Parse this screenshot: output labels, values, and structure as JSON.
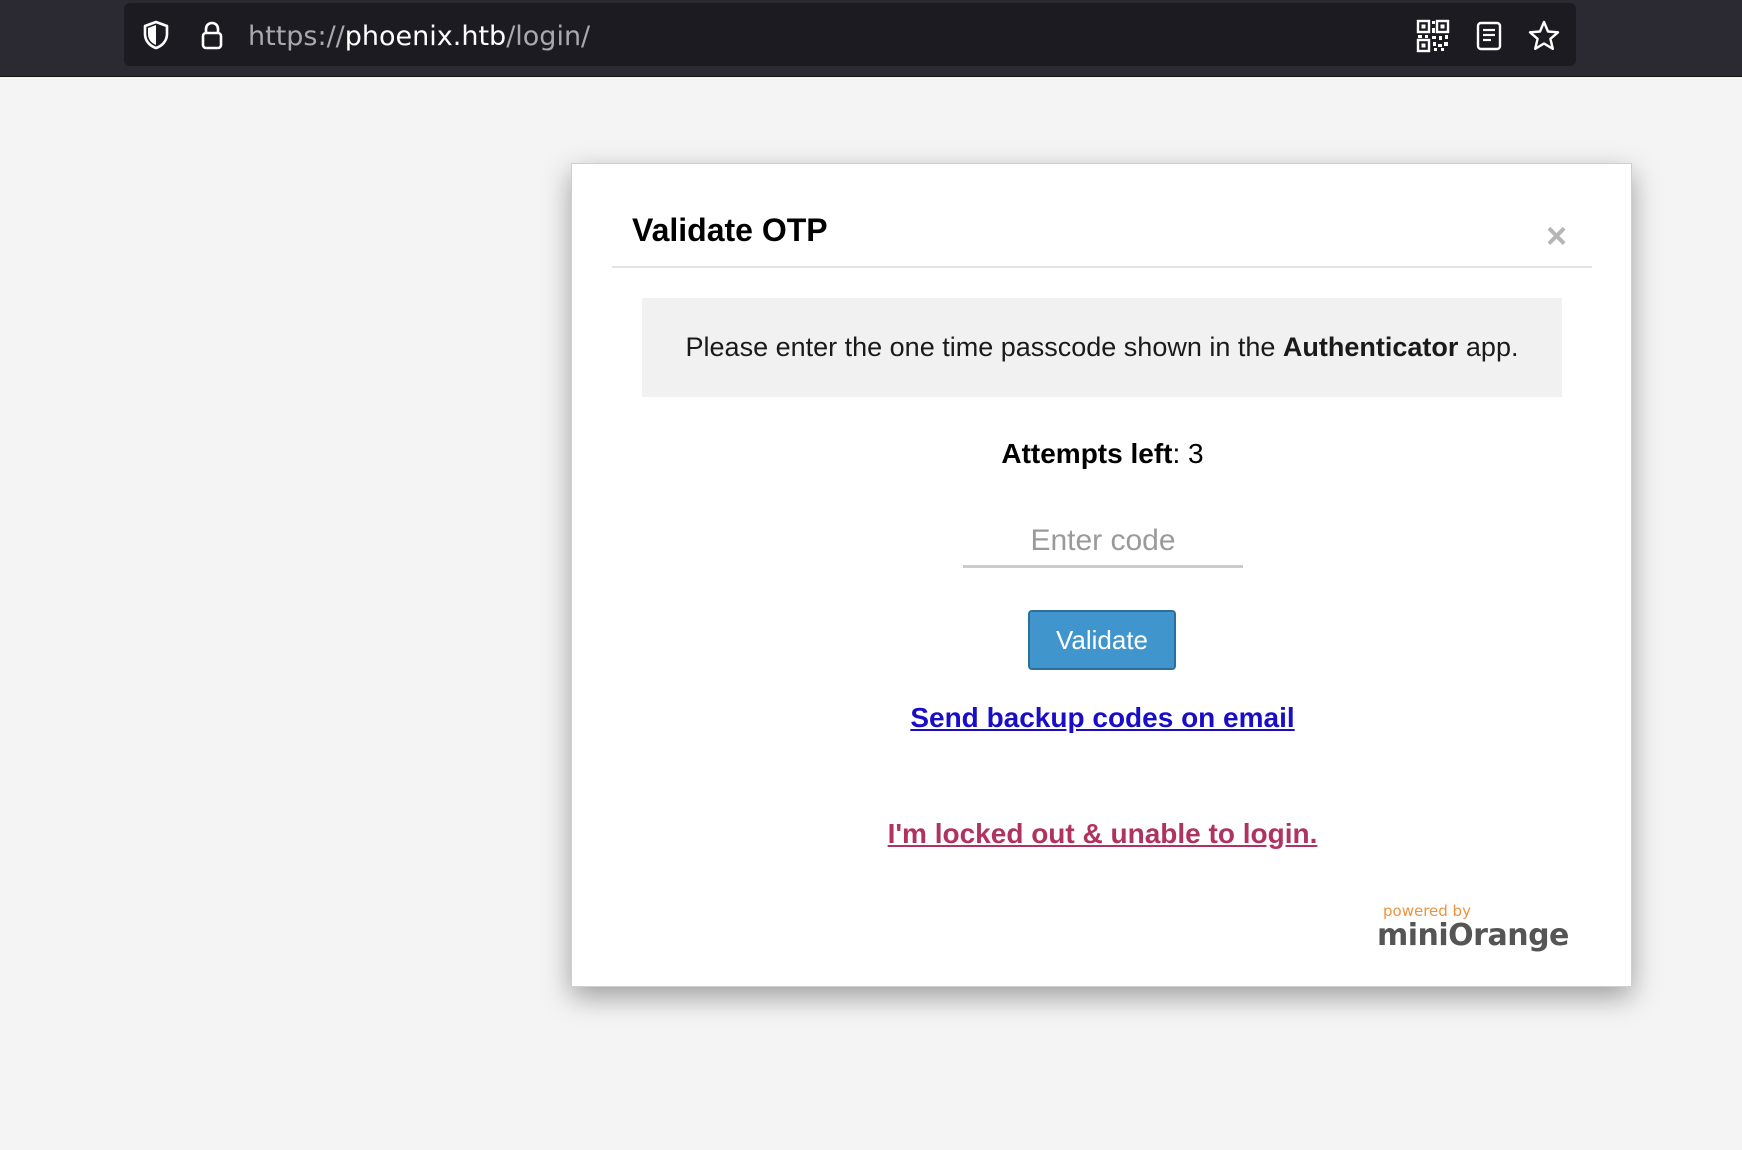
{
  "browser": {
    "url_prefix": "https://",
    "url_host": "phoenix.htb",
    "url_path": "/login/",
    "icons": [
      "shield-icon",
      "lock-icon",
      "qr-code-icon",
      "reader-view-icon",
      "bookmark-star-icon"
    ]
  },
  "dialog": {
    "title": "Validate OTP",
    "close_label": "×",
    "message_before": "Please enter the one time passcode shown in the ",
    "message_bold": "Authenticator",
    "message_after": " app.",
    "attempts_label": "Attempts left",
    "attempts_value": ": 3",
    "code_input": {
      "placeholder": "Enter code",
      "value": ""
    },
    "validate_label": "Validate",
    "backup_link": "Send backup codes on email",
    "locked_out_link": "I'm locked out & unable to login.",
    "powered_by": "powered by",
    "brand": "miniOrange"
  },
  "colors": {
    "primary_button": "#3f95cc",
    "backup_link": "#1a0dc8",
    "locked_link": "#b0335f",
    "brand_orange": "#f0913c"
  }
}
